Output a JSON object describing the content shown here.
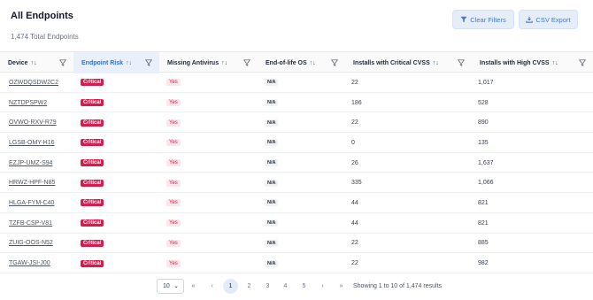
{
  "header": {
    "title": "All Endpoints",
    "subtitle": "1,474 Total Endpoints",
    "clear_filters_label": "Clear Filters",
    "csv_export_label": "CSV Export"
  },
  "table": {
    "columns": [
      {
        "label": "Device",
        "sort": "↑↓"
      },
      {
        "label": "Endpoint Risk",
        "sort": "↑↓"
      },
      {
        "label": "Missing Antivirus",
        "sort": "↑↓"
      },
      {
        "label": "End-of-life OS",
        "sort": "↑↓"
      },
      {
        "label": "Installs with Critical CVSS",
        "sort": "↑↓"
      },
      {
        "label": "Installs with High CVSS",
        "sort": "↑↓"
      }
    ],
    "rows": [
      {
        "device": "OZWDQSDW2C2",
        "risk": "Critical",
        "antivirus": "Yes",
        "eol": "N/A",
        "critical": "22",
        "high": "1,017"
      },
      {
        "device": "NZTDPSPW2",
        "risk": "Critical",
        "antivirus": "Yes",
        "eol": "N/A",
        "critical": "186",
        "high": "528"
      },
      {
        "device": "OVWO-RXV-R79",
        "risk": "Critical",
        "antivirus": "Yes",
        "eol": "N/A",
        "critical": "22",
        "high": "890"
      },
      {
        "device": "LGSB-OMY-H16",
        "risk": "Critical",
        "antivirus": "Yes",
        "eol": "N/A",
        "critical": "0",
        "high": "135"
      },
      {
        "device": "EZJP-UMZ-S94",
        "risk": "Critical",
        "antivirus": "Yes",
        "eol": "N/A",
        "critical": "26",
        "high": "1,637"
      },
      {
        "device": "HRWZ-HPF-N85",
        "risk": "Critical",
        "antivirus": "Yes",
        "eol": "N/A",
        "critical": "335",
        "high": "1,066"
      },
      {
        "device": "HLGA-FYM-C40",
        "risk": "Critical",
        "antivirus": "Yes",
        "eol": "N/A",
        "critical": "44",
        "high": "821"
      },
      {
        "device": "TZFB-CSP-V81",
        "risk": "Critical",
        "antivirus": "Yes",
        "eol": "N/A",
        "critical": "44",
        "high": "821"
      },
      {
        "device": "ZUIG-OOS-N52",
        "risk": "Critical",
        "antivirus": "Yes",
        "eol": "N/A",
        "critical": "22",
        "high": "885"
      },
      {
        "device": "TGAW-JSI-J00",
        "risk": "Critical",
        "antivirus": "Yes",
        "eol": "N/A",
        "critical": "22",
        "high": "982"
      }
    ]
  },
  "pagination": {
    "page_size": "10",
    "first": "«",
    "prev": "‹",
    "pages": [
      "1",
      "2",
      "3",
      "4",
      "5"
    ],
    "next": "›",
    "last": "»",
    "current": "1",
    "showing_text": "Showing 1 to 10 of 1,474 results"
  },
  "colors": {
    "accent": "#2f6fd6",
    "critical": "#d81b4b",
    "yes_bg": "#fde6ea"
  }
}
